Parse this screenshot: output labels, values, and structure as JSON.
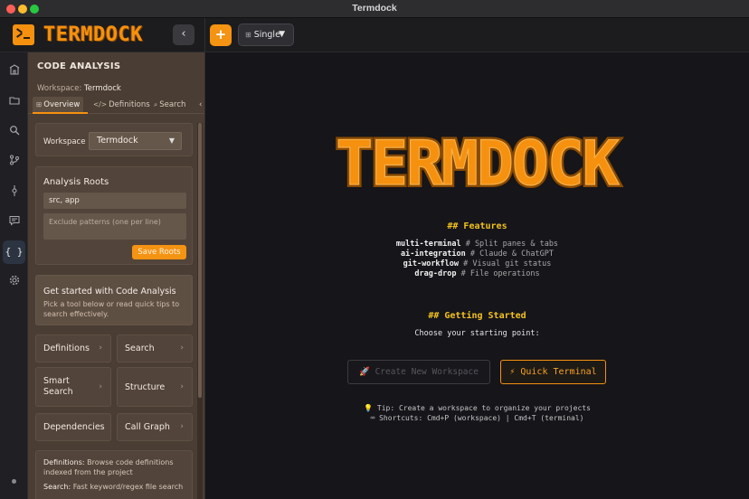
{
  "window": {
    "title": "Termdock"
  },
  "topbar": {
    "logo_text": "TERMDOCK",
    "collapse_glyph": "‹",
    "plus_glyph": "+",
    "layout_label": "Single",
    "layout_icon": "⊞",
    "layout_caret": "▼"
  },
  "iconbar": [
    "home-icon",
    "folder-icon",
    "search-icon",
    "git-branch-icon",
    "git-commit-icon",
    "chat-icon",
    "code-braces-icon",
    "gear-icon"
  ],
  "iconbar_active_glyph": "{ }",
  "panel": {
    "title": "CODE ANALYSIS",
    "workspace_prefix": "Workspace:",
    "workspace_name": "Termdock",
    "tabs": [
      {
        "icon": "⊞",
        "label": "Overview"
      },
      {
        "icon": "</>",
        "label": "Definitions"
      },
      {
        "icon": "⌕",
        "label": "Search"
      }
    ],
    "tabs_overflow": "‹",
    "workspace_label": "Workspace",
    "workspace_select": "Termdock",
    "roots_title": "Analysis Roots",
    "roots_value": "src, app",
    "exclude_placeholder": "Exclude patterns (one per line)",
    "save_roots": "Save Roots",
    "getstarted_title": "Get started with Code Analysis",
    "getstarted_sub": "Pick a tool below or read quick tips to search effectively.",
    "tools": [
      {
        "label": "Definitions"
      },
      {
        "label": "Search"
      },
      {
        "label": "Smart Search"
      },
      {
        "label": "Structure"
      },
      {
        "label": "Dependencies"
      },
      {
        "label": "Call Graph"
      }
    ],
    "chevron": "›",
    "info": [
      {
        "key": "Definitions:",
        "text": "Browse code definitions indexed from the project"
      },
      {
        "key": "Search:",
        "text": "Fast keyword/regex file search"
      }
    ]
  },
  "main": {
    "features_heading": "## Features",
    "features": [
      {
        "name": "multi-terminal",
        "desc": "# Split panes & tabs"
      },
      {
        "name": "ai-integration",
        "desc": "# Claude & ChatGPT"
      },
      {
        "name": "git-workflow",
        "desc": "# Visual git status"
      },
      {
        "name": "drag-drop",
        "desc": "# File operations"
      }
    ],
    "getting_started_heading": "## Getting Started",
    "choose_text": "Choose your starting point:",
    "create_workspace": "🚀 Create New Workspace",
    "quick_terminal": "⚡ Quick Terminal",
    "tip_line1": "💡 Tip: Create a workspace to organize your projects",
    "tip_line2": "⌨ Shortcuts: Cmd+P (workspace) | Cmd+T (terminal)"
  },
  "colors": {
    "accent": "#f5910f",
    "heading_yellow": "#f4c21c",
    "panel_bg": "#4a3d33",
    "main_bg": "#15151a"
  }
}
